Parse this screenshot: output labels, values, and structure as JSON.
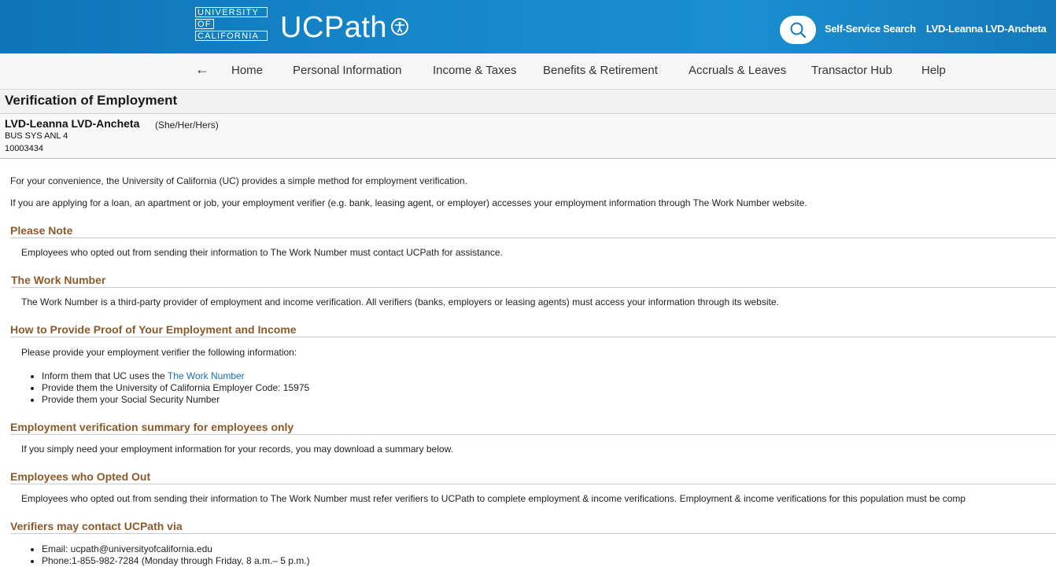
{
  "header": {
    "logo_lines": [
      "UNIVERSITY",
      "OF",
      "CALIFORNIA"
    ],
    "brand": "UCPath",
    "search_label": "Self-Service Search",
    "user_name": "LVD-Leanna LVD-Ancheta"
  },
  "nav": {
    "back_icon": "←",
    "items": [
      "Home",
      "Personal Information",
      "Income & Taxes",
      "Benefits & Retirement",
      "Accruals & Leaves",
      "Transactor Hub",
      "Help"
    ]
  },
  "page": {
    "title": "Verification of Employment",
    "employee": {
      "name": "LVD-Leanna LVD-Ancheta",
      "pronouns": "(She/Her/Hers)",
      "job_title": "BUS SYS ANL 4",
      "id": "10003434"
    },
    "intro": [
      "For your convenience, the University of California (UC) provides a simple method for employment verification.",
      "If you are applying for a loan, an apartment or job, your employment verifier (e.g. bank, leasing agent, or employer) accesses your employment information through The Work Number website."
    ],
    "sections": [
      {
        "heading": "Please Note",
        "text": "Employees who opted out from sending their information to The Work Number must contact UCPath for assistance."
      },
      {
        "heading": "The Work Number",
        "text": "The Work Number is a third-party provider of employment and income verification. All verifiers (banks, employers or leasing agents) must access your information through its website."
      },
      {
        "heading": "How to Provide Proof of Your Employment and Income",
        "text": "Please provide your employment verifier the following information:",
        "bullets": {
          "b1_prefix": "Inform them that UC uses the ",
          "b1_link": "The Work Number",
          "b2": "Provide them the University of California Employer Code: 15975",
          "b3": "Provide them your Social Security Number"
        }
      },
      {
        "heading": "Employment verification summary for employees only",
        "text": "If you simply need your employment information for your records, you may download a summary below."
      },
      {
        "heading": "Employees who Opted Out",
        "text": "Employees who opted out from sending their information to The Work Number must refer verifiers to UCPath to complete employment & income verifications. Employment & income verifications for this population must be comp"
      },
      {
        "heading": "Verifiers may contact UCPath via",
        "bullets": {
          "b1": "Email: ucpath@universityofcalifornia.edu",
          "b2": "Phone:1-855-982-7284 (Monday through Friday, 8 a.m.– 5 p.m.)"
        }
      }
    ]
  },
  "icons": {
    "accessibility": "accessibility-icon",
    "search": "search-icon",
    "back": "back-arrow-icon"
  },
  "colors": {
    "header": "#1587c9",
    "section_heading": "#8b5a2b",
    "link": "#1a6db0"
  }
}
